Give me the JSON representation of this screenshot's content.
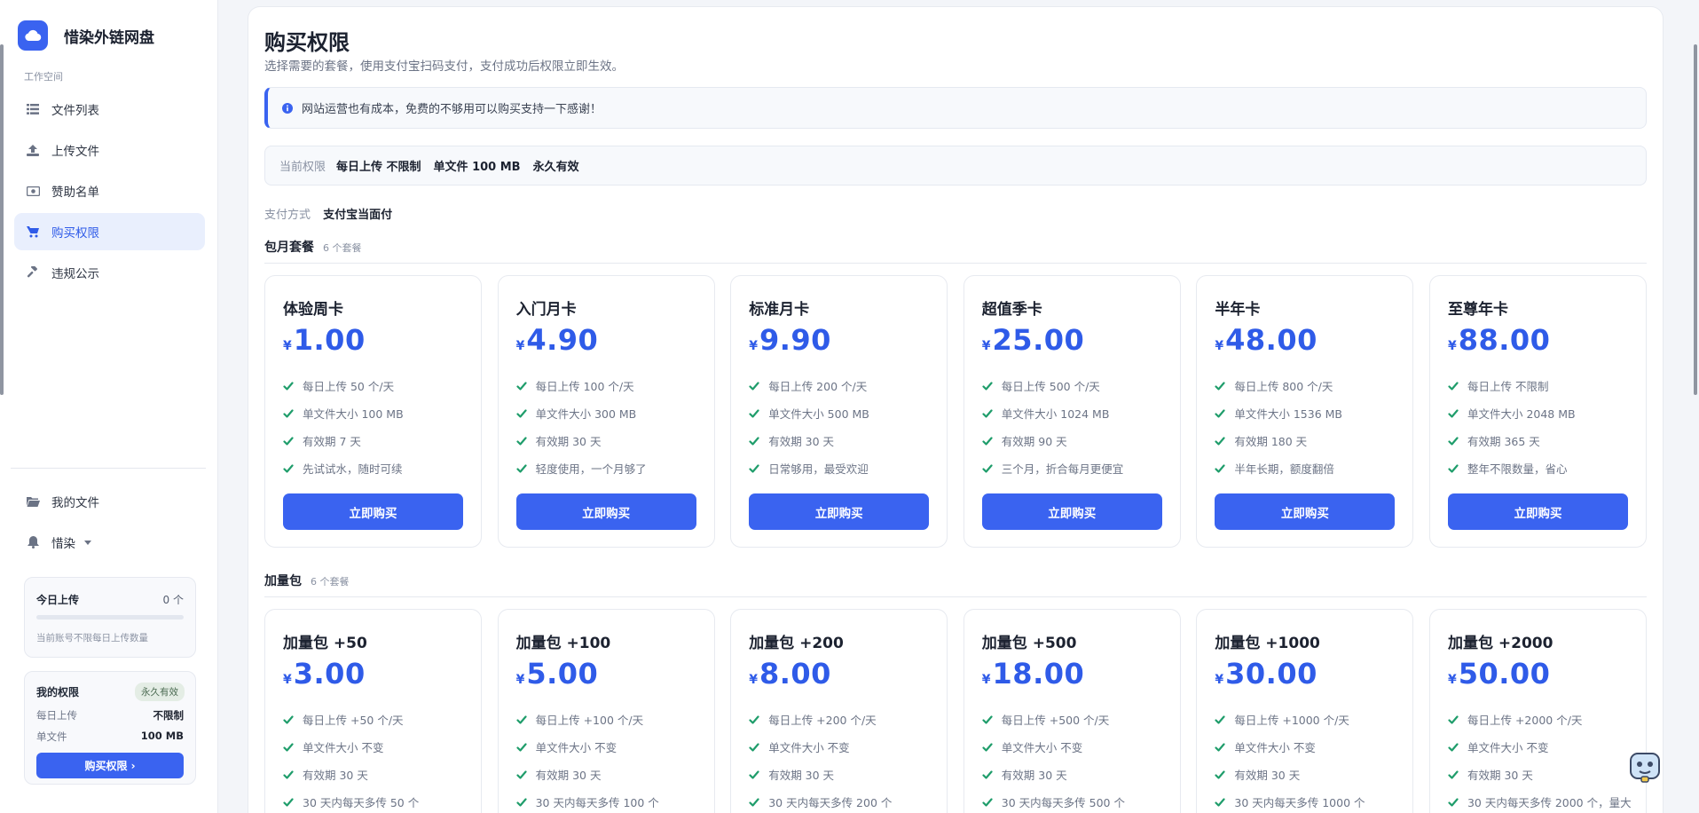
{
  "app": {
    "name": "惜染外链网盘"
  },
  "sidebar": {
    "section_label": "工作空间",
    "items": [
      {
        "label": "文件列表",
        "icon": "list-icon"
      },
      {
        "label": "上传文件",
        "icon": "upload-icon"
      },
      {
        "label": "赞助名单",
        "icon": "money-icon"
      },
      {
        "label": "购买权限",
        "icon": "cart-icon",
        "active": true
      },
      {
        "label": "违规公示",
        "icon": "gavel-icon"
      }
    ],
    "bottom_items": [
      {
        "label": "我的文件",
        "icon": "folder-icon"
      },
      {
        "label": "惜染",
        "icon": "bell-icon"
      }
    ],
    "today": {
      "label": "今日上传",
      "value": "0 个",
      "progress": 0,
      "note": "当前账号不限每日上传数量"
    },
    "perm": {
      "title": "我的权限",
      "badge": "永久有效",
      "daily_label": "每日上传",
      "daily_value": "不限制",
      "size_label": "单文件",
      "size_value": "100 MB",
      "button": "购买权限 ›"
    }
  },
  "main": {
    "title": "购买权限",
    "subtitle": "选择需要的套餐，使用支付宝扫码支付，支付成功后权限立即生效。",
    "notice": "网站运营也有成本，免费的不够用可以购买支持一下感谢！",
    "current": {
      "label": "当前权限",
      "daily": "每日上传 不限制",
      "size": "单文件 100 MB",
      "validity": "永久有效"
    },
    "payment": {
      "label": "支付方式",
      "value": "支付宝当面付"
    },
    "groups": [
      {
        "name": "包月套餐",
        "count": "6 个套餐",
        "plans": [
          {
            "name": "体验周卡",
            "currency": "¥",
            "price": "1.00",
            "features": [
              "每日上传 50 个/天",
              "单文件大小 100 MB",
              "有效期 7 天",
              "先试试水，随时可续"
            ],
            "button": "立即购买"
          },
          {
            "name": "入门月卡",
            "currency": "¥",
            "price": "4.90",
            "features": [
              "每日上传 100 个/天",
              "单文件大小 300 MB",
              "有效期 30 天",
              "轻度使用，一个月够了"
            ],
            "button": "立即购买"
          },
          {
            "name": "标准月卡",
            "currency": "¥",
            "price": "9.90",
            "features": [
              "每日上传 200 个/天",
              "单文件大小 500 MB",
              "有效期 30 天",
              "日常够用，最受欢迎"
            ],
            "button": "立即购买"
          },
          {
            "name": "超值季卡",
            "currency": "¥",
            "price": "25.00",
            "features": [
              "每日上传 500 个/天",
              "单文件大小 1024 MB",
              "有效期 90 天",
              "三个月，折合每月更便宜"
            ],
            "button": "立即购买"
          },
          {
            "name": "半年卡",
            "currency": "¥",
            "price": "48.00",
            "features": [
              "每日上传 800 个/天",
              "单文件大小 1536 MB",
              "有效期 180 天",
              "半年长期，额度翻倍"
            ],
            "button": "立即购买"
          },
          {
            "name": "至尊年卡",
            "currency": "¥",
            "price": "88.00",
            "features": [
              "每日上传 不限制",
              "单文件大小 2048 MB",
              "有效期 365 天",
              "整年不限数量，省心"
            ],
            "button": "立即购买"
          }
        ]
      },
      {
        "name": "加量包",
        "count": "6 个套餐",
        "plans": [
          {
            "name": "加量包 +50",
            "currency": "¥",
            "price": "3.00",
            "features": [
              "每日上传 +50 个/天",
              "单文件大小 不变",
              "有效期 30 天",
              "30 天内每天多传 50 个"
            ]
          },
          {
            "name": "加量包 +100",
            "currency": "¥",
            "price": "5.00",
            "features": [
              "每日上传 +100 个/天",
              "单文件大小 不变",
              "有效期 30 天",
              "30 天内每天多传 100 个"
            ]
          },
          {
            "name": "加量包 +200",
            "currency": "¥",
            "price": "8.00",
            "features": [
              "每日上传 +200 个/天",
              "单文件大小 不变",
              "有效期 30 天",
              "30 天内每天多传 200 个"
            ]
          },
          {
            "name": "加量包 +500",
            "currency": "¥",
            "price": "18.00",
            "features": [
              "每日上传 +500 个/天",
              "单文件大小 不变",
              "有效期 30 天",
              "30 天内每天多传 500 个"
            ]
          },
          {
            "name": "加量包 +1000",
            "currency": "¥",
            "price": "30.00",
            "features": [
              "每日上传 +1000 个/天",
              "单文件大小 不变",
              "有效期 30 天",
              "30 天内每天多传 1000 个"
            ]
          },
          {
            "name": "加量包 +2000",
            "currency": "¥",
            "price": "50.00",
            "features": [
              "每日上传 +2000 个/天",
              "单文件大小 不变",
              "有效期 30 天",
              "30 天内每天多传 2000 个，量大"
            ]
          }
        ]
      }
    ]
  },
  "colors": {
    "accent": "#3a63f0",
    "check": "#1f9d6b",
    "active_bg": "#e9effd"
  }
}
